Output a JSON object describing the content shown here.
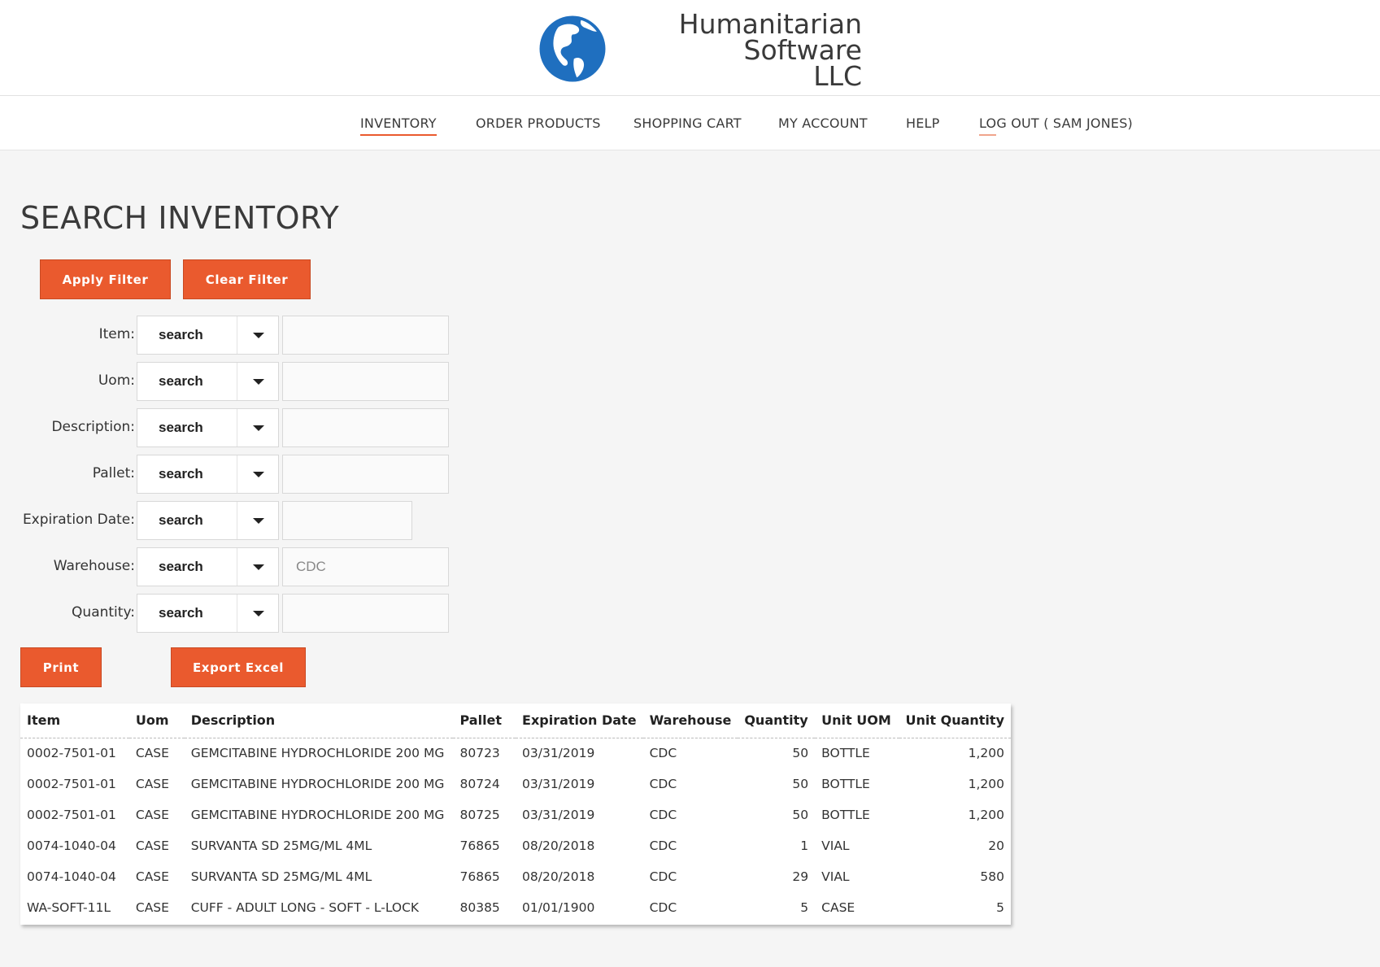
{
  "brand": {
    "line1": "Humanitarian Software",
    "line2": "LLC",
    "globe_colors": {
      "ocean": "#1f6fbf",
      "land": "#ffffff"
    }
  },
  "nav": {
    "inventory": "INVENTORY",
    "order_products": "ORDER PRODUCTS",
    "shopping_cart": "SHOPPING CART",
    "my_account": "MY ACCOUNT",
    "help": "HELP",
    "logout_prefix": "LO",
    "logout_rest": "G OUT ( SAM JONES)"
  },
  "page": {
    "title": "SEARCH INVENTORY"
  },
  "buttons": {
    "apply_filter": "Apply Filter",
    "clear_filter": "Clear Filter",
    "print": "Print",
    "export_excel": "Export Excel"
  },
  "filters": {
    "item": {
      "label": "Item:",
      "operator": "search",
      "value": "",
      "placeholder": ""
    },
    "uom": {
      "label": "Uom:",
      "operator": "search",
      "value": "",
      "placeholder": ""
    },
    "description": {
      "label": "Description:",
      "operator": "search",
      "value": "",
      "placeholder": ""
    },
    "pallet": {
      "label": "Pallet:",
      "operator": "search",
      "value": "",
      "placeholder": ""
    },
    "expiration_date": {
      "label": "Expiration Date:",
      "operator": "search",
      "value": "",
      "placeholder": ""
    },
    "warehouse": {
      "label": "Warehouse:",
      "operator": "search",
      "value": "",
      "placeholder": "CDC"
    },
    "quantity": {
      "label": "Quantity:",
      "operator": "search",
      "value": "",
      "placeholder": ""
    }
  },
  "table": {
    "headers": {
      "item": "Item",
      "uom": "Uom",
      "description": "Description",
      "pallet": "Pallet",
      "expiration_date": "Expiration Date",
      "warehouse": "Warehouse",
      "quantity": "Quantity",
      "unit_uom": "Unit UOM",
      "unit_quantity": "Unit Quantity"
    },
    "rows": [
      {
        "item": "0002-7501-01",
        "uom": "CASE",
        "description": "GEMCITABINE HYDROCHLORIDE 200 MG",
        "pallet": "80723",
        "expiration_date": "03/31/2019",
        "warehouse": "CDC",
        "quantity": "50",
        "unit_uom": "BOTTLE",
        "unit_quantity": "1,200"
      },
      {
        "item": "0002-7501-01",
        "uom": "CASE",
        "description": "GEMCITABINE HYDROCHLORIDE 200 MG",
        "pallet": "80724",
        "expiration_date": "03/31/2019",
        "warehouse": "CDC",
        "quantity": "50",
        "unit_uom": "BOTTLE",
        "unit_quantity": "1,200"
      },
      {
        "item": "0002-7501-01",
        "uom": "CASE",
        "description": "GEMCITABINE HYDROCHLORIDE 200 MG",
        "pallet": "80725",
        "expiration_date": "03/31/2019",
        "warehouse": "CDC",
        "quantity": "50",
        "unit_uom": "BOTTLE",
        "unit_quantity": "1,200"
      },
      {
        "item": "0074-1040-04",
        "uom": "CASE",
        "description": "SURVANTA SD 25MG/ML 4ML",
        "pallet": "76865",
        "expiration_date": "08/20/2018",
        "warehouse": "CDC",
        "quantity": "1",
        "unit_uom": "VIAL",
        "unit_quantity": "20"
      },
      {
        "item": "0074-1040-04",
        "uom": "CASE",
        "description": "SURVANTA SD 25MG/ML 4ML",
        "pallet": "76865",
        "expiration_date": "08/20/2018",
        "warehouse": "CDC",
        "quantity": "29",
        "unit_uom": "VIAL",
        "unit_quantity": "580"
      },
      {
        "item": "WA-SOFT-11L",
        "uom": "CASE",
        "description": "CUFF - ADULT LONG - SOFT - L-LOCK",
        "pallet": "80385",
        "expiration_date": "01/01/1900",
        "warehouse": "CDC",
        "quantity": "5",
        "unit_uom": "CASE",
        "unit_quantity": "5"
      }
    ]
  },
  "theme": {
    "accent": "#ea5a2e",
    "background": "#f5f5f5"
  }
}
